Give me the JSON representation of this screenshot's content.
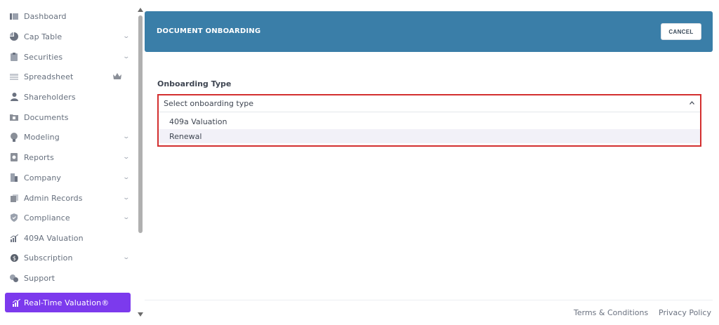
{
  "sidebar": {
    "items": [
      {
        "label": "Dashboard",
        "icon": "dashboard-icon",
        "chevron": false
      },
      {
        "label": "Cap Table",
        "icon": "pie-chart-icon",
        "chevron": true
      },
      {
        "label": "Securities",
        "icon": "clipboard-icon",
        "chevron": true
      },
      {
        "label": "Spreadsheet",
        "icon": "spreadsheet-icon",
        "chevron": false,
        "crown": true
      },
      {
        "label": "Shareholders",
        "icon": "user-icon",
        "chevron": false
      },
      {
        "label": "Documents",
        "icon": "folder-icon",
        "chevron": false
      },
      {
        "label": "Modeling",
        "icon": "lightbulb-icon",
        "chevron": true
      },
      {
        "label": "Reports",
        "icon": "report-icon",
        "chevron": true
      },
      {
        "label": "Company",
        "icon": "building-icon",
        "chevron": true
      },
      {
        "label": "Admin Records",
        "icon": "records-icon",
        "chevron": true
      },
      {
        "label": "Compliance",
        "icon": "shield-icon",
        "chevron": true
      },
      {
        "label": "409A Valuation",
        "icon": "bar-chart-icon",
        "chevron": false
      },
      {
        "label": "Subscription",
        "icon": "dollar-icon",
        "chevron": true
      },
      {
        "label": "Support",
        "icon": "support-icon",
        "chevron": false
      }
    ],
    "active_item": {
      "label": "Real-Time Valuation®",
      "icon": "bar-chart-icon"
    }
  },
  "header": {
    "title": "DOCUMENT ONBOARDING",
    "cancel_label": "CANCEL"
  },
  "form": {
    "onboarding_label": "Onboarding Type",
    "select_placeholder": "Select onboarding type",
    "options": [
      "409a Valuation",
      "Renewal"
    ]
  },
  "footer": {
    "terms": "Terms & Conditions",
    "privacy": "Privacy Policy"
  },
  "colors": {
    "header_bg": "#3a7ea8",
    "active_nav_bg": "#7c3aed",
    "dropdown_border": "#d32f2f"
  }
}
